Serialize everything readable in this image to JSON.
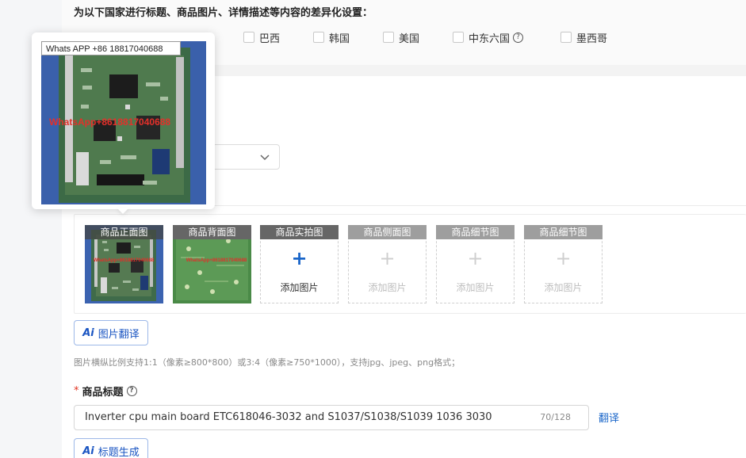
{
  "section_title": "为以下国家进行标题、商品图片、详情描述等内容的差异化设置：",
  "countries": [
    {
      "label": "巴西"
    },
    {
      "label": "韩国"
    },
    {
      "label": "美国"
    },
    {
      "label": "中东六国",
      "has_help": true
    },
    {
      "label": "墨西哥"
    }
  ],
  "image_slots": [
    {
      "label": "商品正面图",
      "state": "filled"
    },
    {
      "label": "商品背面图",
      "state": "filled"
    },
    {
      "label": "商品实拍图",
      "state": "add",
      "add_label": "添加图片"
    },
    {
      "label": "商品侧面图",
      "state": "disabled",
      "add_label": "添加图片"
    },
    {
      "label": "商品细节图",
      "state": "disabled",
      "add_label": "添加图片"
    },
    {
      "label": "商品细节图",
      "state": "disabled",
      "add_label": "添加图片"
    }
  ],
  "image_translate_button": {
    "icon": "Ai",
    "label": "图片翻译"
  },
  "image_hint": "图片横纵比例支持1:1（像素≥800*800）或3:4（像素≥750*1000），支持jpg、jpeg、png格式；",
  "title_field": {
    "label": "商品标题",
    "value": "Inverter cpu main board ETC618046-3032 and S1037/S1038/S1039 1036 3030",
    "count": "70/128"
  },
  "translate_link": "翻译",
  "title_generate_button": {
    "icon": "Ai",
    "label": "标题生成"
  },
  "preview_popup": {
    "watermark_text": "Whats APP +86 18817040688",
    "overlay_text": "WhatsApp+8618817040688"
  },
  "colors": {
    "accent": "#1a66c9",
    "required": "#e0301e"
  }
}
